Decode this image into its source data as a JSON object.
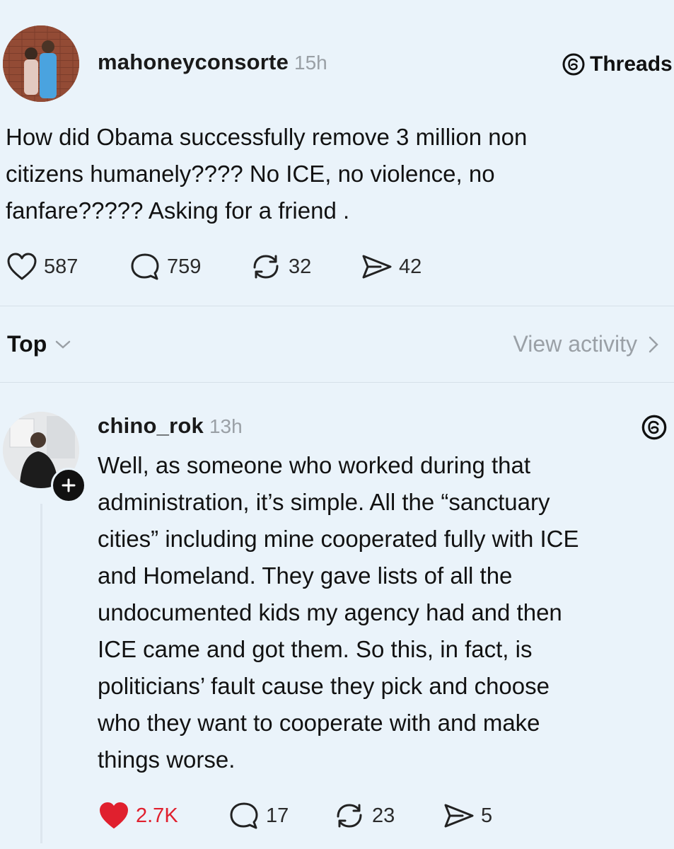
{
  "post": {
    "username": "mahoneyconsorte",
    "time": "15h",
    "brand": "Threads",
    "text_lines": [
      "How did Obama successfully remove 3 million non",
      "citizens humanely???? No ICE, no violence, no",
      "fanfare????? Asking for a friend ."
    ],
    "likes": "587",
    "replies": "759",
    "reposts": "32",
    "shares": "42"
  },
  "sort": {
    "label": "Top",
    "view_activity": "View activity"
  },
  "reply": {
    "username": "chino_rok",
    "time": "13h",
    "text_lines": [
      "Well, as someone who worked during that",
      "administration, it’s simple. All the “sanctuary",
      "cities” including mine cooperated fully with ICE",
      "and Homeland. They gave lists of all the",
      "undocumented kids my agency had and then",
      "ICE came and got them. So this, in fact, is",
      "politicians’ fault cause they pick and choose",
      "who they want to cooperate with and make",
      "things worse."
    ],
    "likes": "2.7K",
    "replies": "17",
    "reposts": "23",
    "shares": "5",
    "liked_color": "#e0202e"
  }
}
